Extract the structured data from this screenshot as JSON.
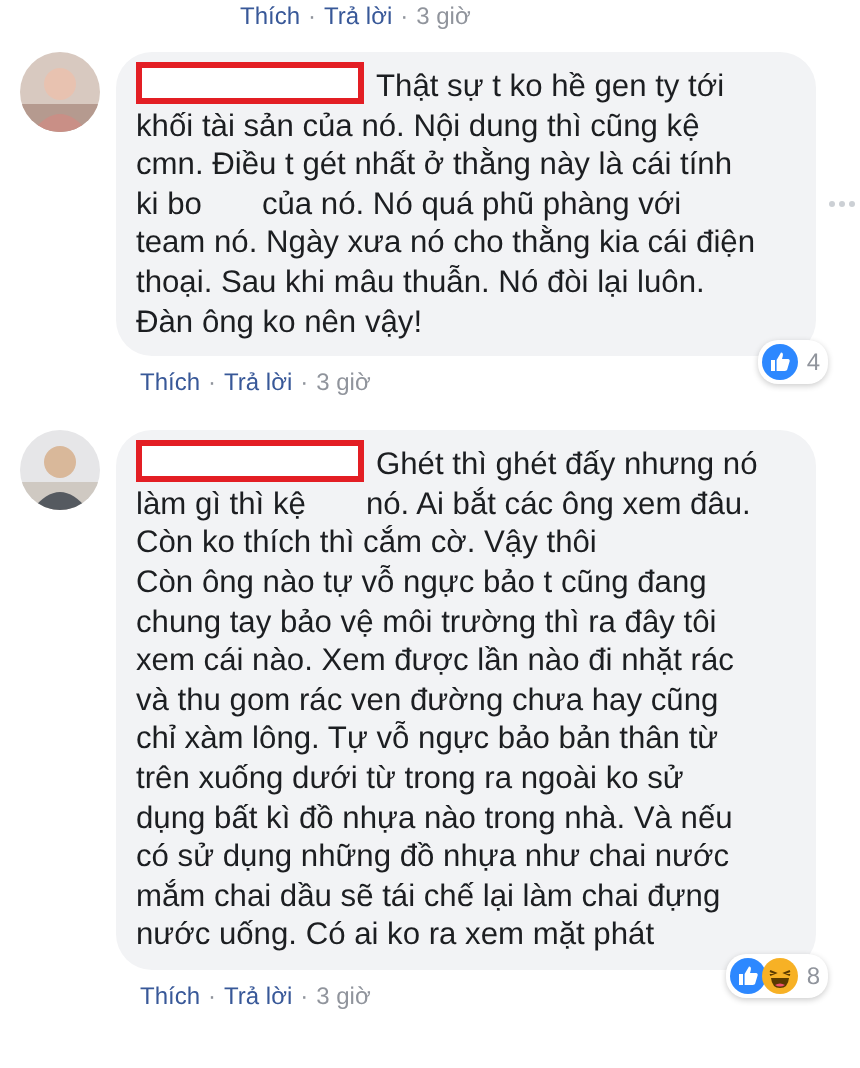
{
  "previous_comment_actions": [
    {
      "kind": "link",
      "text": "Thích"
    },
    {
      "kind": "separator",
      "text": "·"
    },
    {
      "kind": "link",
      "text": "Trả lời"
    },
    {
      "kind": "separator",
      "text": "·"
    },
    {
      "kind": "time",
      "text": "3 giờ"
    }
  ],
  "comments": [
    {
      "name_redacted": true,
      "options_visible": true,
      "lines": [
        "Thật sự t ko hề gen ty tới",
        "khối tài sản của nó. Nội dung thì cũng kệ",
        "cmn. Điều t gét nhất ở thằng này là cái tính",
        [
          "ki bo",
          "của nó. Nó quá phũ phàng với"
        ],
        "team nó. Ngày xưa nó cho thằng kia cái điện",
        "thoại. Sau khi mâu thuẫn. Nó đòi lại luôn.",
        "Đàn ông ko nên vậy!"
      ],
      "reactions": {
        "icons": [
          {
            "kind": "like"
          }
        ],
        "count": "4"
      },
      "actions": [
        {
          "kind": "link",
          "text": "Thích"
        },
        {
          "kind": "separator",
          "text": "·"
        },
        {
          "kind": "link",
          "text": "Trả lời"
        },
        {
          "kind": "separator",
          "text": "·"
        },
        {
          "kind": "time",
          "text": "3 giờ"
        }
      ]
    },
    {
      "name_redacted": true,
      "options_visible": false,
      "lines": [
        "Ghét thì ghét đấy nhưng nó",
        [
          "làm gì thì kệ",
          "nó. Ai bắt các ông xem đâu."
        ],
        "Còn ko thích thì cắm cờ. Vậy thôi",
        "Còn ông nào tự vỗ ngực bảo t cũng đang",
        "chung tay bảo vệ môi trường thì ra đây tôi",
        "xem cái nào. Xem được lần nào đi nhặt rác",
        "và thu gom rác ven đường chưa hay cũng",
        "chỉ xàm lông. Tự vỗ ngực bảo bản thân từ",
        "trên xuống dưới từ trong ra ngoài ko sử",
        "dụng bất kì đồ nhựa nào trong nhà. Và nếu",
        "có sử dụng những đồ nhựa như chai nước",
        "mắm chai dầu sẽ tái chế lại làm chai đựng",
        "nước uống. Có ai ko ra xem mặt phát"
      ],
      "reactions": {
        "icons": [
          {
            "kind": "like"
          },
          {
            "kind": "haha"
          }
        ],
        "count": "8"
      },
      "actions": [
        {
          "kind": "link",
          "text": "Thích"
        },
        {
          "kind": "separator",
          "text": "·"
        },
        {
          "kind": "link",
          "text": "Trả lời"
        },
        {
          "kind": "separator",
          "text": "·"
        },
        {
          "kind": "time",
          "text": "3 giờ"
        }
      ]
    }
  ]
}
